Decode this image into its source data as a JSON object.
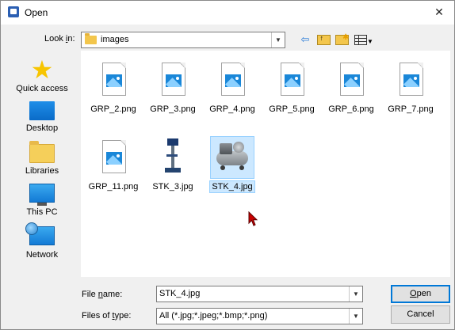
{
  "window": {
    "title": "Open",
    "close_glyph": "✕"
  },
  "look_in": {
    "label_prefix": "Look ",
    "label_accel": "i",
    "label_suffix": "n:",
    "value": "images"
  },
  "toolbar": {
    "back_icon": "⇦",
    "up_icon": "up-folder-icon",
    "new_folder_icon": "new-folder-icon",
    "view_menu_icon": "view-menu-icon"
  },
  "places": [
    {
      "label": "Quick access",
      "icon": "star-icon"
    },
    {
      "label": "Desktop",
      "icon": "desktop-icon"
    },
    {
      "label": "Libraries",
      "icon": "libraries-icon"
    },
    {
      "label": "This PC",
      "icon": "pc-icon"
    },
    {
      "label": "Network",
      "icon": "network-icon"
    }
  ],
  "files": [
    {
      "name": "GRP_2.png",
      "kind": "png"
    },
    {
      "name": "GRP_3.png",
      "kind": "png"
    },
    {
      "name": "GRP_4.png",
      "kind": "png"
    },
    {
      "name": "GRP_5.png",
      "kind": "png"
    },
    {
      "name": "GRP_6.png",
      "kind": "png"
    },
    {
      "name": "GRP_7.png",
      "kind": "png"
    },
    {
      "name": "GRP_11.png",
      "kind": "png"
    },
    {
      "name": "STK_3.jpg",
      "kind": "drill-photo"
    },
    {
      "name": "STK_4.jpg",
      "kind": "compressor-photo",
      "selected": true
    }
  ],
  "file_name": {
    "label_pre": "File ",
    "label_accel": "n",
    "label_post": "ame:",
    "value": "STK_4.jpg"
  },
  "file_type": {
    "label_pre": "Files of ",
    "label_accel": "t",
    "label_post": "ype:",
    "value": "All (*.jpg;*.jpeg;*.bmp;*.png)"
  },
  "buttons": {
    "open_accel": "O",
    "open_rest": "pen",
    "cancel": "Cancel"
  },
  "colors": {
    "selection": "#cce8ff",
    "accent": "#0078d7",
    "cursor": "#c80000"
  }
}
